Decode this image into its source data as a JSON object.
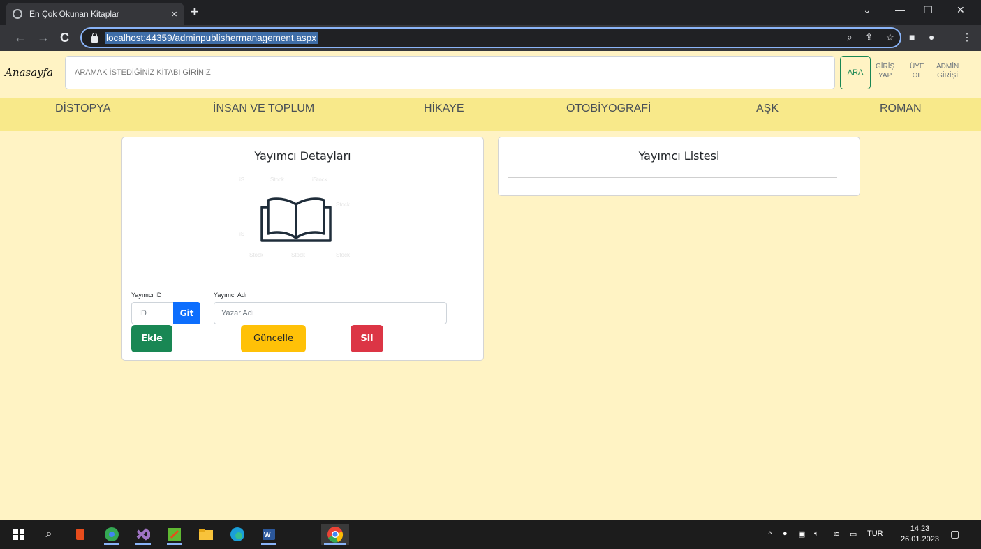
{
  "browser": {
    "tab_title": "En Çok Okunan Kitaplar",
    "tab_close": "×",
    "new_tab": "+",
    "url": "localhost:44359/adminpublishermanagement.aspx",
    "win_min": "—",
    "win_restore": "❐",
    "win_close": "✕",
    "win_dropdown": "⌄"
  },
  "header": {
    "brand": "Anasayfa",
    "search_placeholder": "ARAMAK İSTEDİĞİNİZ KİTABI GİRİNİZ",
    "search_button": "ARA",
    "login": [
      "GİRİŞ",
      "YAP"
    ],
    "register": [
      "ÜYE",
      "OL"
    ],
    "admin": [
      "ADMİN",
      "GİRİŞİ"
    ]
  },
  "categories": [
    "DİSTOPYA",
    "İNSAN VE TOPLUM",
    "HİKAYE",
    "OTOBİYOGRAFİ",
    "AŞK",
    "ROMAN"
  ],
  "details_card": {
    "title": "Yayımcı Detayları",
    "id_label": "Yayımcı ID",
    "name_label": "Yayımcı Adı",
    "id_placeholder": "ID",
    "go_button": "Git",
    "name_placeholder": "Yazar Adı",
    "add_button": "Ekle",
    "update_button": "Güncelle",
    "delete_button": "Sil"
  },
  "list_card": {
    "title": "Yayımcı Listesi"
  },
  "taskbar": {
    "lang": "TUR",
    "time": "14:23",
    "date": "26.01.2023"
  },
  "colors": {
    "page_bg": "#fff3c4",
    "category_bar": "#f8e98a",
    "success": "#198754",
    "warning": "#ffc107",
    "danger": "#dc3545",
    "primary": "#0d6efd"
  }
}
